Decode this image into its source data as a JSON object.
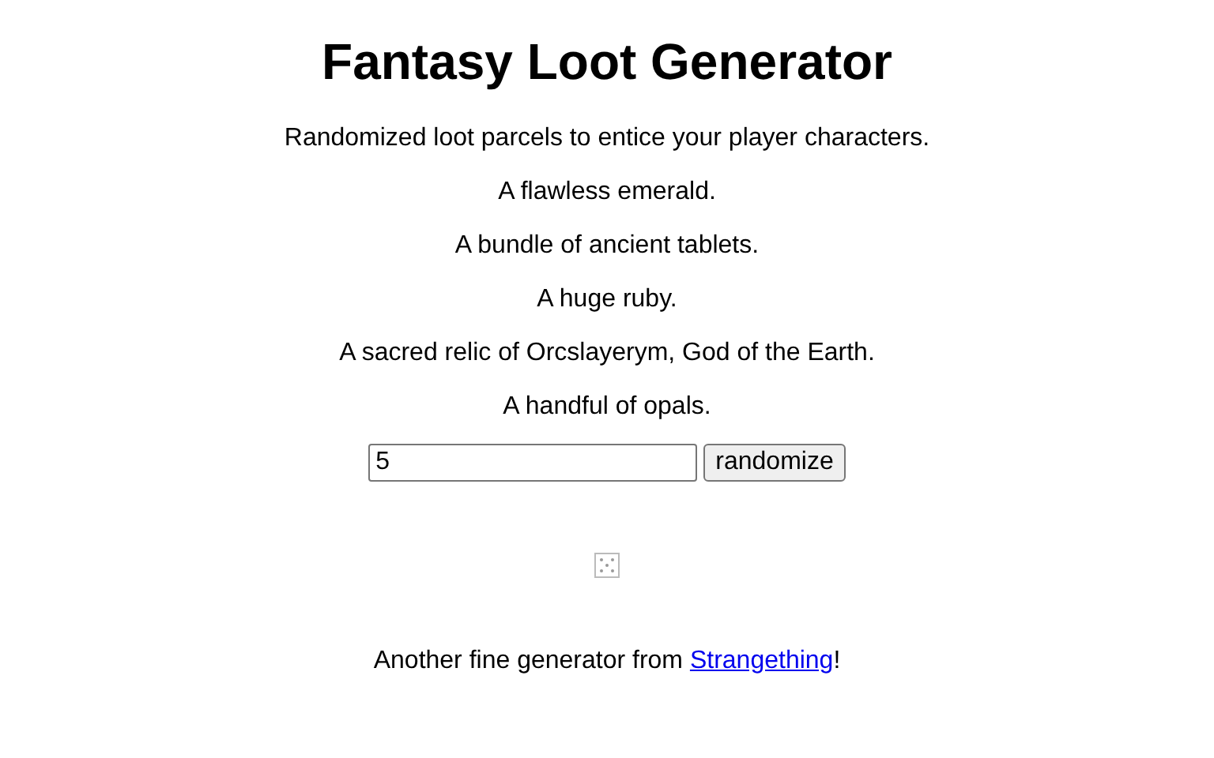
{
  "title": "Fantasy Loot Generator",
  "subtitle": "Randomized loot parcels to entice your player characters.",
  "items": [
    "A flawless emerald.",
    "A bundle of ancient tablets.",
    "A huge ruby.",
    "A sacred relic of Orcslayerym, God of the Earth.",
    "A handful of opals."
  ],
  "count_field": {
    "value": "5"
  },
  "button": "randomize",
  "footer": {
    "before": "Another fine generator from ",
    "link": "Strangething",
    "after": "!"
  }
}
